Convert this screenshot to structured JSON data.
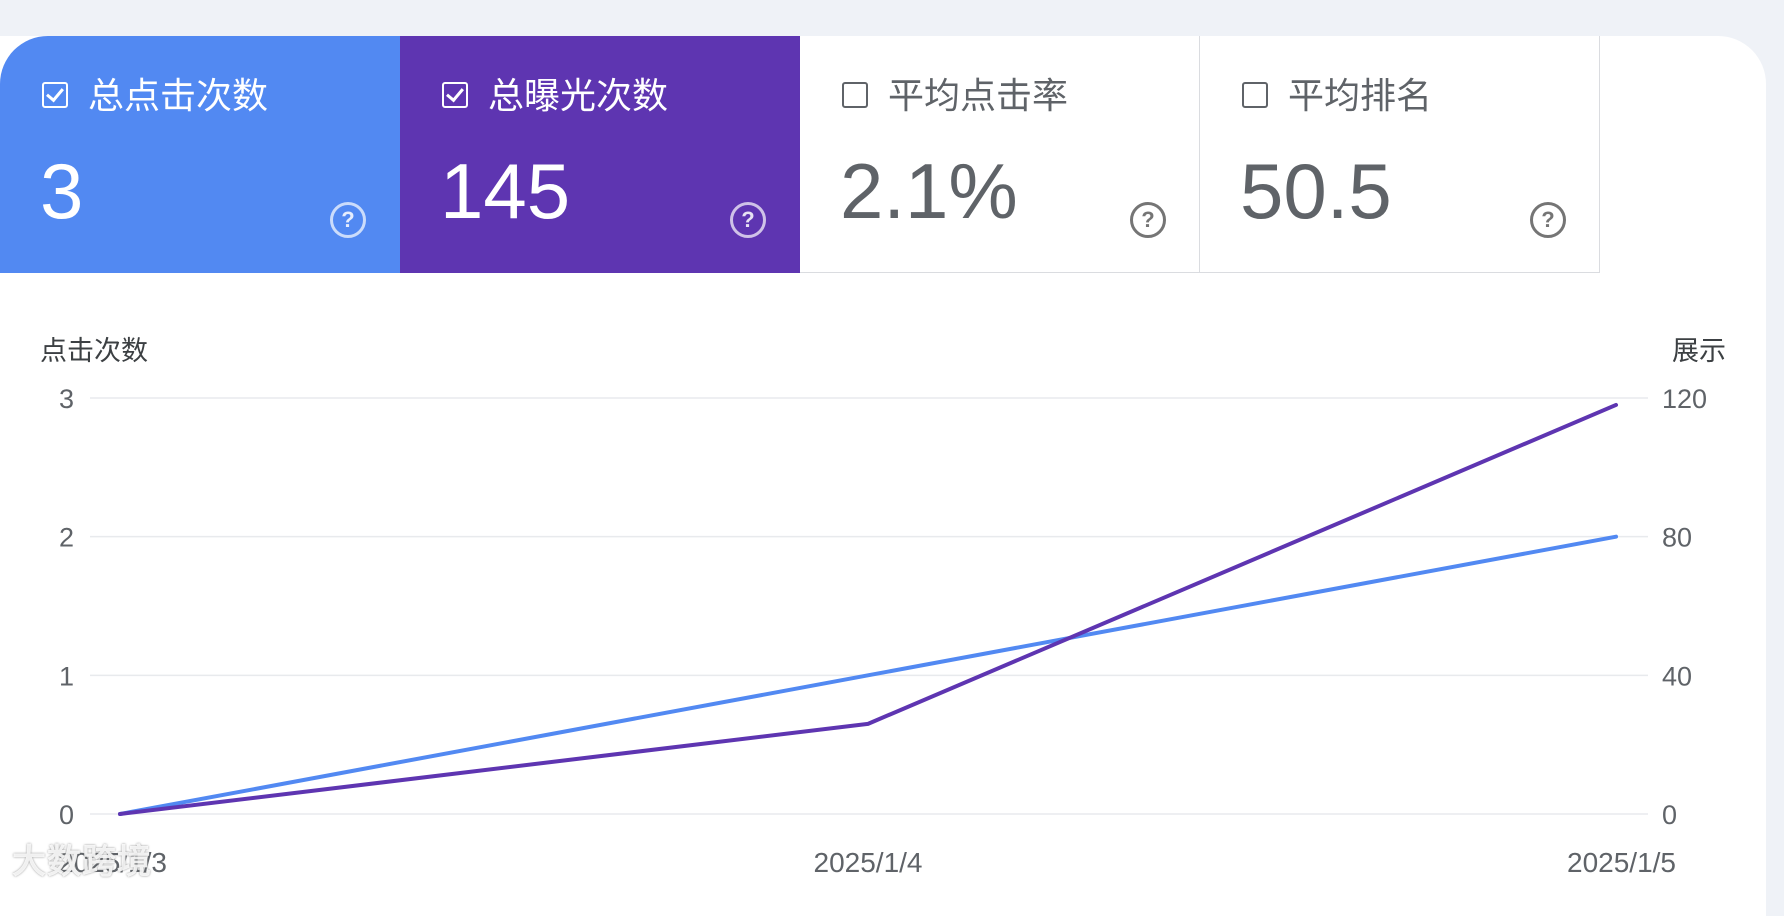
{
  "metrics": [
    {
      "label": "总点击次数",
      "value": "3",
      "checked": true
    },
    {
      "label": "总曝光次数",
      "value": "145",
      "checked": true
    },
    {
      "label": "平均点击率",
      "value": "2.1%",
      "checked": false
    },
    {
      "label": "平均排名",
      "value": "50.5",
      "checked": false
    }
  ],
  "help_glyph": "?",
  "watermark": "大数跨境",
  "colors": {
    "clicks": "#5289f2",
    "impressions": "#5e35b1"
  },
  "chart_data": {
    "type": "line",
    "x": [
      "2025/1/3",
      "2025/1/4",
      "2025/1/5"
    ],
    "series": [
      {
        "name": "点击次数",
        "axis": "left",
        "values": [
          0,
          1,
          2
        ],
        "color": "#5289f2"
      },
      {
        "name": "展示",
        "axis": "right",
        "values": [
          0,
          26,
          118
        ],
        "color": "#5e35b1"
      }
    ],
    "ylabel_left": "点击次数",
    "ylabel_right": "展示",
    "yticks_left": [
      0,
      1,
      2,
      3
    ],
    "yticks_right": [
      0,
      40,
      80,
      120
    ],
    "ylim_left": [
      0,
      3
    ],
    "ylim_right": [
      0,
      120
    ],
    "grid": true
  }
}
